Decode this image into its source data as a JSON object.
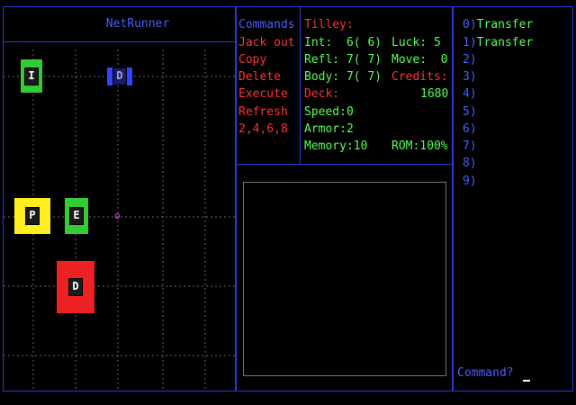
{
  "map": {
    "title": "NetRunner",
    "nodes": {
      "top_left": "I",
      "top_mid": "D",
      "mid_left": "P",
      "mid_right": "E",
      "bottom": "D",
      "small": "o"
    }
  },
  "commands": {
    "title": "Commands",
    "items": [
      "Jack out",
      "Copy",
      "Delete",
      "Execute",
      "Refresh",
      "2,4,6,8"
    ]
  },
  "stats": {
    "name": "Tilley:",
    "int": "Int:  6( 6)",
    "luck": "Luck: 5",
    "refl": "Refl: 7( 7)",
    "move": "Move:  0",
    "body": "Body: 7( 7)",
    "credits_label": "Credits:",
    "deck_label": "Deck:",
    "credits_value": "1680",
    "speed": "Speed:0",
    "armor": "Armor:2",
    "memory": "Memory:10",
    "rom": "ROM:100%"
  },
  "programs": {
    "items": [
      "0)Transfer",
      "1)Transfer",
      "2)",
      "3)",
      "4)",
      "5)",
      "6)",
      "7)",
      "8)",
      "9)"
    ]
  },
  "prompt": {
    "label": "Command?"
  },
  "colors": {
    "frame": "#2a3bd8",
    "title": "#4a5cff",
    "command_text": "#ff3333",
    "stat_text": "#55ff55",
    "node_green": "#33cc33",
    "node_yellow": "#ffee22",
    "node_red": "#ee2222",
    "node_blue": "#3344ff"
  }
}
